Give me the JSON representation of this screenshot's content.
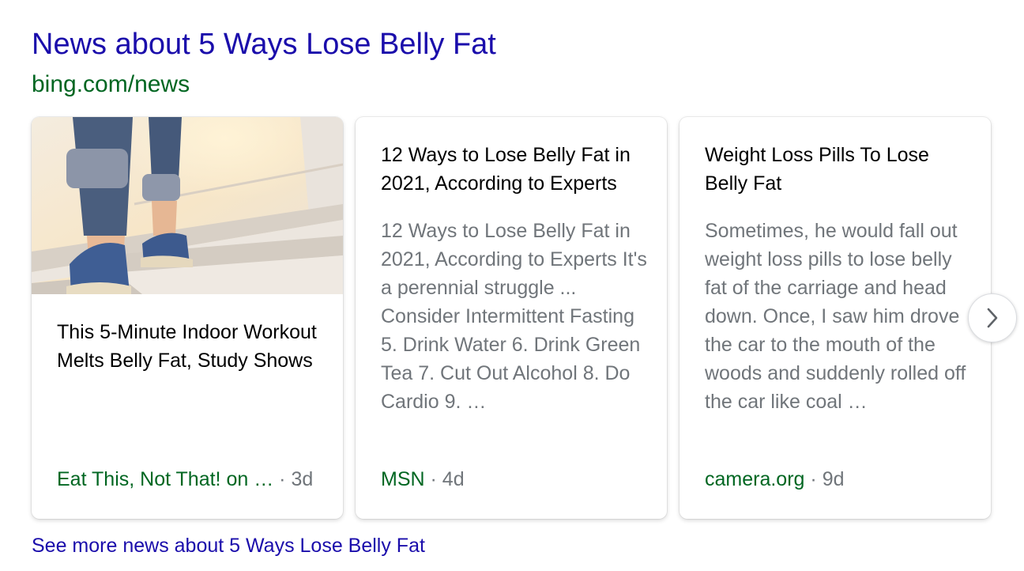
{
  "header": {
    "title": "News about 5 Ways Lose Belly Fat",
    "url": "bing.com/news"
  },
  "cards": [
    {
      "has_image": true,
      "image_subject": "feet in jeans and sneakers walking up stairs",
      "title": "This 5-Minute Indoor Workout Melts Belly Fat, Study Shows",
      "source": "Eat This, Not That! on …",
      "separator": "·",
      "age": "3d"
    },
    {
      "has_image": false,
      "title": "12 Ways to Lose Belly Fat in 2021, According to Experts",
      "snippet": "12 Ways to Lose Belly Fat in 2021, According to Experts It's a perennial struggle ... Consider Intermittent Fasting 5. Drink Water 6. Drink Green Tea 7. Cut Out Alcohol 8. Do Cardio 9. …",
      "source": "MSN",
      "separator": "·",
      "age": "4d"
    },
    {
      "has_image": false,
      "title": "Weight Loss Pills To Lose Belly Fat",
      "snippet": "Sometimes, he would fall out weight loss pills to lose belly fat of the carriage and head down. Once, I saw him drove the car to the mouth of the woods and suddenly rolled off the car like coal …",
      "source": "camera.org",
      "separator": "·",
      "age": "9d"
    }
  ],
  "carousel": {
    "next_icon": "chevron-right-icon"
  },
  "footer": {
    "see_more": "See more news about 5 Ways Lose Belly Fat"
  },
  "colors": {
    "link": "#1a0dab",
    "url_green": "#006621",
    "snippet_gray": "#70757a"
  }
}
